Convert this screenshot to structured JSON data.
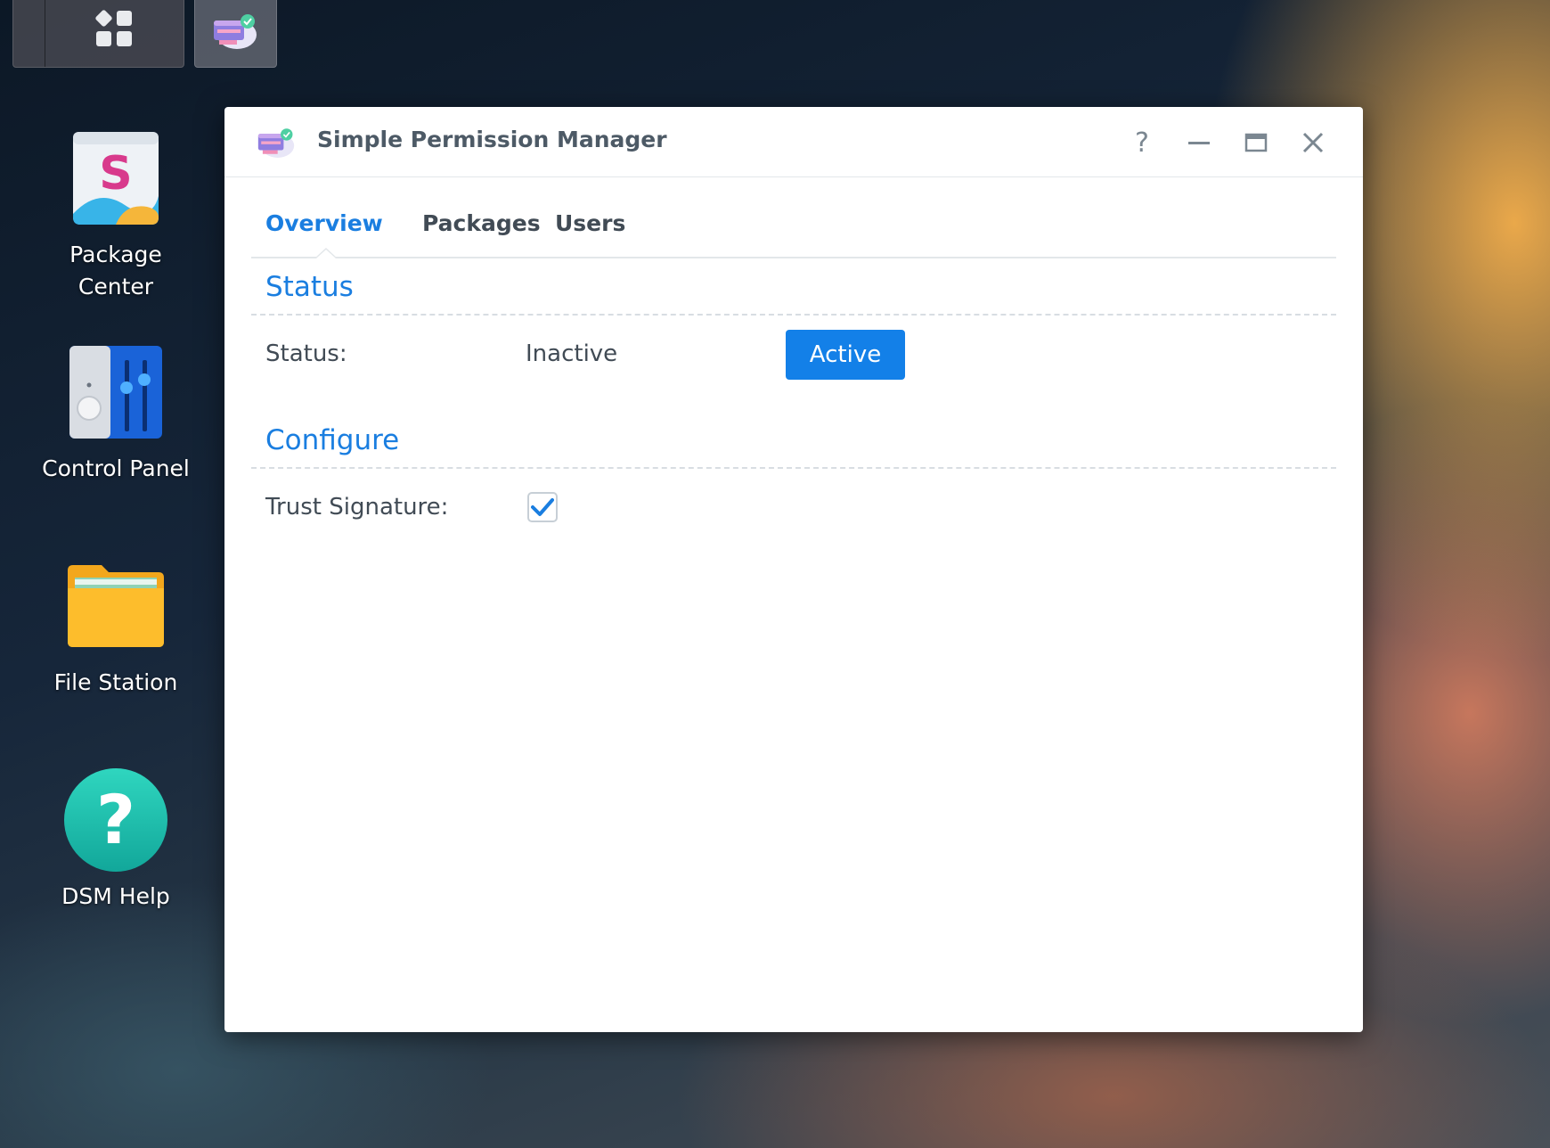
{
  "taskbar": {
    "main_menu_icon": "grid-icon",
    "running_app_icon": "permission-manager-icon"
  },
  "desktop": {
    "icons": [
      {
        "label": "Package\nCenter",
        "icon": "package-center-icon"
      },
      {
        "label": "Control Panel",
        "icon": "control-panel-icon"
      },
      {
        "label": "File Station",
        "icon": "folder-icon"
      },
      {
        "label": "DSM Help",
        "icon": "help-icon"
      }
    ]
  },
  "window": {
    "title": "Simple Permission Manager",
    "controls": {
      "help": "?",
      "minimize": "—",
      "maximize": "▭",
      "close": "✕"
    },
    "tabs": [
      {
        "label": "Overview",
        "active": true
      },
      {
        "label": "Packages",
        "active": false
      },
      {
        "label": "Users",
        "active": false
      }
    ],
    "status_section": {
      "title": "Status",
      "label": "Status:",
      "value": "Inactive",
      "button": "Active"
    },
    "configure_section": {
      "title": "Configure",
      "trust_label": "Trust Signature:",
      "trust_checked": true
    }
  },
  "colors": {
    "accent": "#1a7ee0",
    "button": "#1380e8",
    "text": "#414b55",
    "title_text": "#4d5a66"
  }
}
